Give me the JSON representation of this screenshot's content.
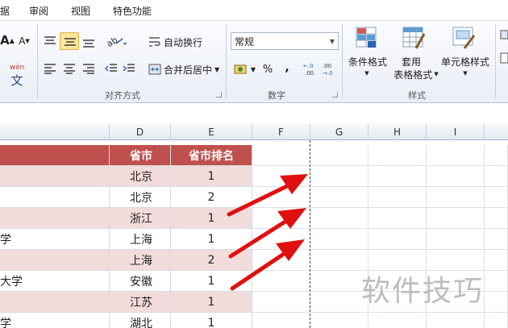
{
  "menu": [
    "据",
    "审阅",
    "视图",
    "特色功能"
  ],
  "ribbon": {
    "font_group": {
      "grow_font": "A",
      "shrink_font": "A",
      "wen_label": "wén",
      "wen_char": "文"
    },
    "align_group": {
      "wrap_text": "自动换行",
      "merge_center": "合并后居中",
      "label": "对齐方式"
    },
    "number_group": {
      "format_value": "常规",
      "percent": "%",
      "comma": ",",
      "inc_decimal": "+.0 .00",
      "dec_decimal": ".00 →.0",
      "label": "数字"
    },
    "styles_group": {
      "cond_format": "条件格式",
      "table_format_1": "套用",
      "table_format_2": "表格格式",
      "cell_styles": "单元格样式",
      "label": "样式"
    }
  },
  "columns": [
    "D",
    "E",
    "F",
    "G",
    "H",
    "I"
  ],
  "table": {
    "headers": [
      "省市",
      "省市排名"
    ],
    "rows": [
      {
        "prefix": "",
        "province": "北京",
        "rank": "1"
      },
      {
        "prefix": "",
        "province": "北京",
        "rank": "2"
      },
      {
        "prefix": "",
        "province": "浙江",
        "rank": "1"
      },
      {
        "prefix": "学",
        "province": "上海",
        "rank": "1"
      },
      {
        "prefix": "",
        "province": "上海",
        "rank": "2"
      },
      {
        "prefix": "大学",
        "province": "安徽",
        "rank": "1"
      },
      {
        "prefix": "",
        "province": "江苏",
        "rank": "1"
      },
      {
        "prefix": "学",
        "province": "湖北",
        "rank": "1"
      }
    ]
  },
  "watermark": "软件技巧",
  "colors": {
    "header_fill": "#c0504d",
    "band_fill": "#f2dcdb",
    "arrow": "#e01010"
  }
}
